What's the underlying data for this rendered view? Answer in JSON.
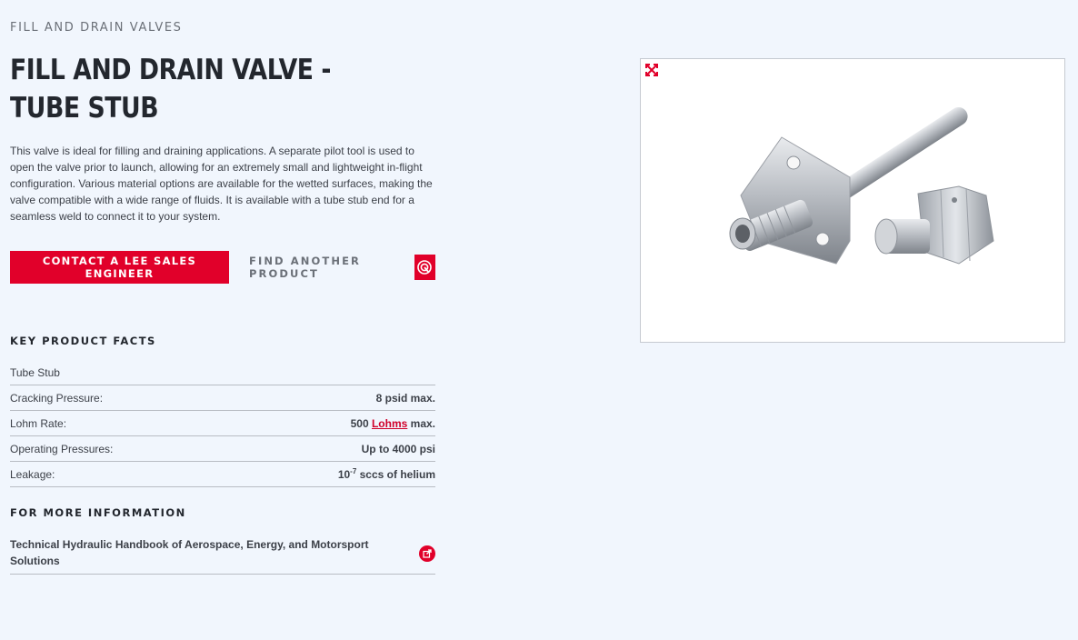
{
  "breadcrumb": "FILL AND DRAIN VALVES",
  "title": "FILL AND DRAIN VALVE - TUBE STUB",
  "description": "This valve is ideal for filling and draining applications. A separate pilot tool is used to open the valve prior to launch, allowing for an extremely small and lightweight in-flight configuration. Various material options are available for the wetted surfaces, making the valve compatible with a wide range of fluids. It is available with a tube stub end for a seamless weld to connect it to your system.",
  "cta_label": "CONTACT A LEE SALES ENGINEER",
  "find_label": "FIND ANOTHER PRODUCT",
  "find_icon": "search-target-icon",
  "key_facts": {
    "heading": "KEY PRODUCT FACTS",
    "type_label": "Tube Stub",
    "rows": [
      {
        "label": "Cracking Pressure:",
        "value": "8 psid max."
      },
      {
        "label": "Lohm Rate:",
        "value_prefix": "500 ",
        "value_link": "Lohms",
        "value_suffix": " max."
      },
      {
        "label": "Operating Pressures:",
        "value": "Up to 4000 psi"
      },
      {
        "label": "Leakage:",
        "value_base": "10",
        "value_exp": "-7",
        "value_suffix": " sccs of helium"
      }
    ]
  },
  "more_info": {
    "heading": "FOR MORE INFORMATION",
    "link_text": "Technical Hydraulic Handbook of Aerospace, Energy, and Motorsport Solutions",
    "icon": "external-link-icon"
  },
  "media": {
    "expand_icon": "expand-icon",
    "image_subject": "stainless-steel-valve-product-image"
  },
  "colors": {
    "accent": "#e1002a",
    "background": "#f1f6fd",
    "text": "#23272e"
  }
}
